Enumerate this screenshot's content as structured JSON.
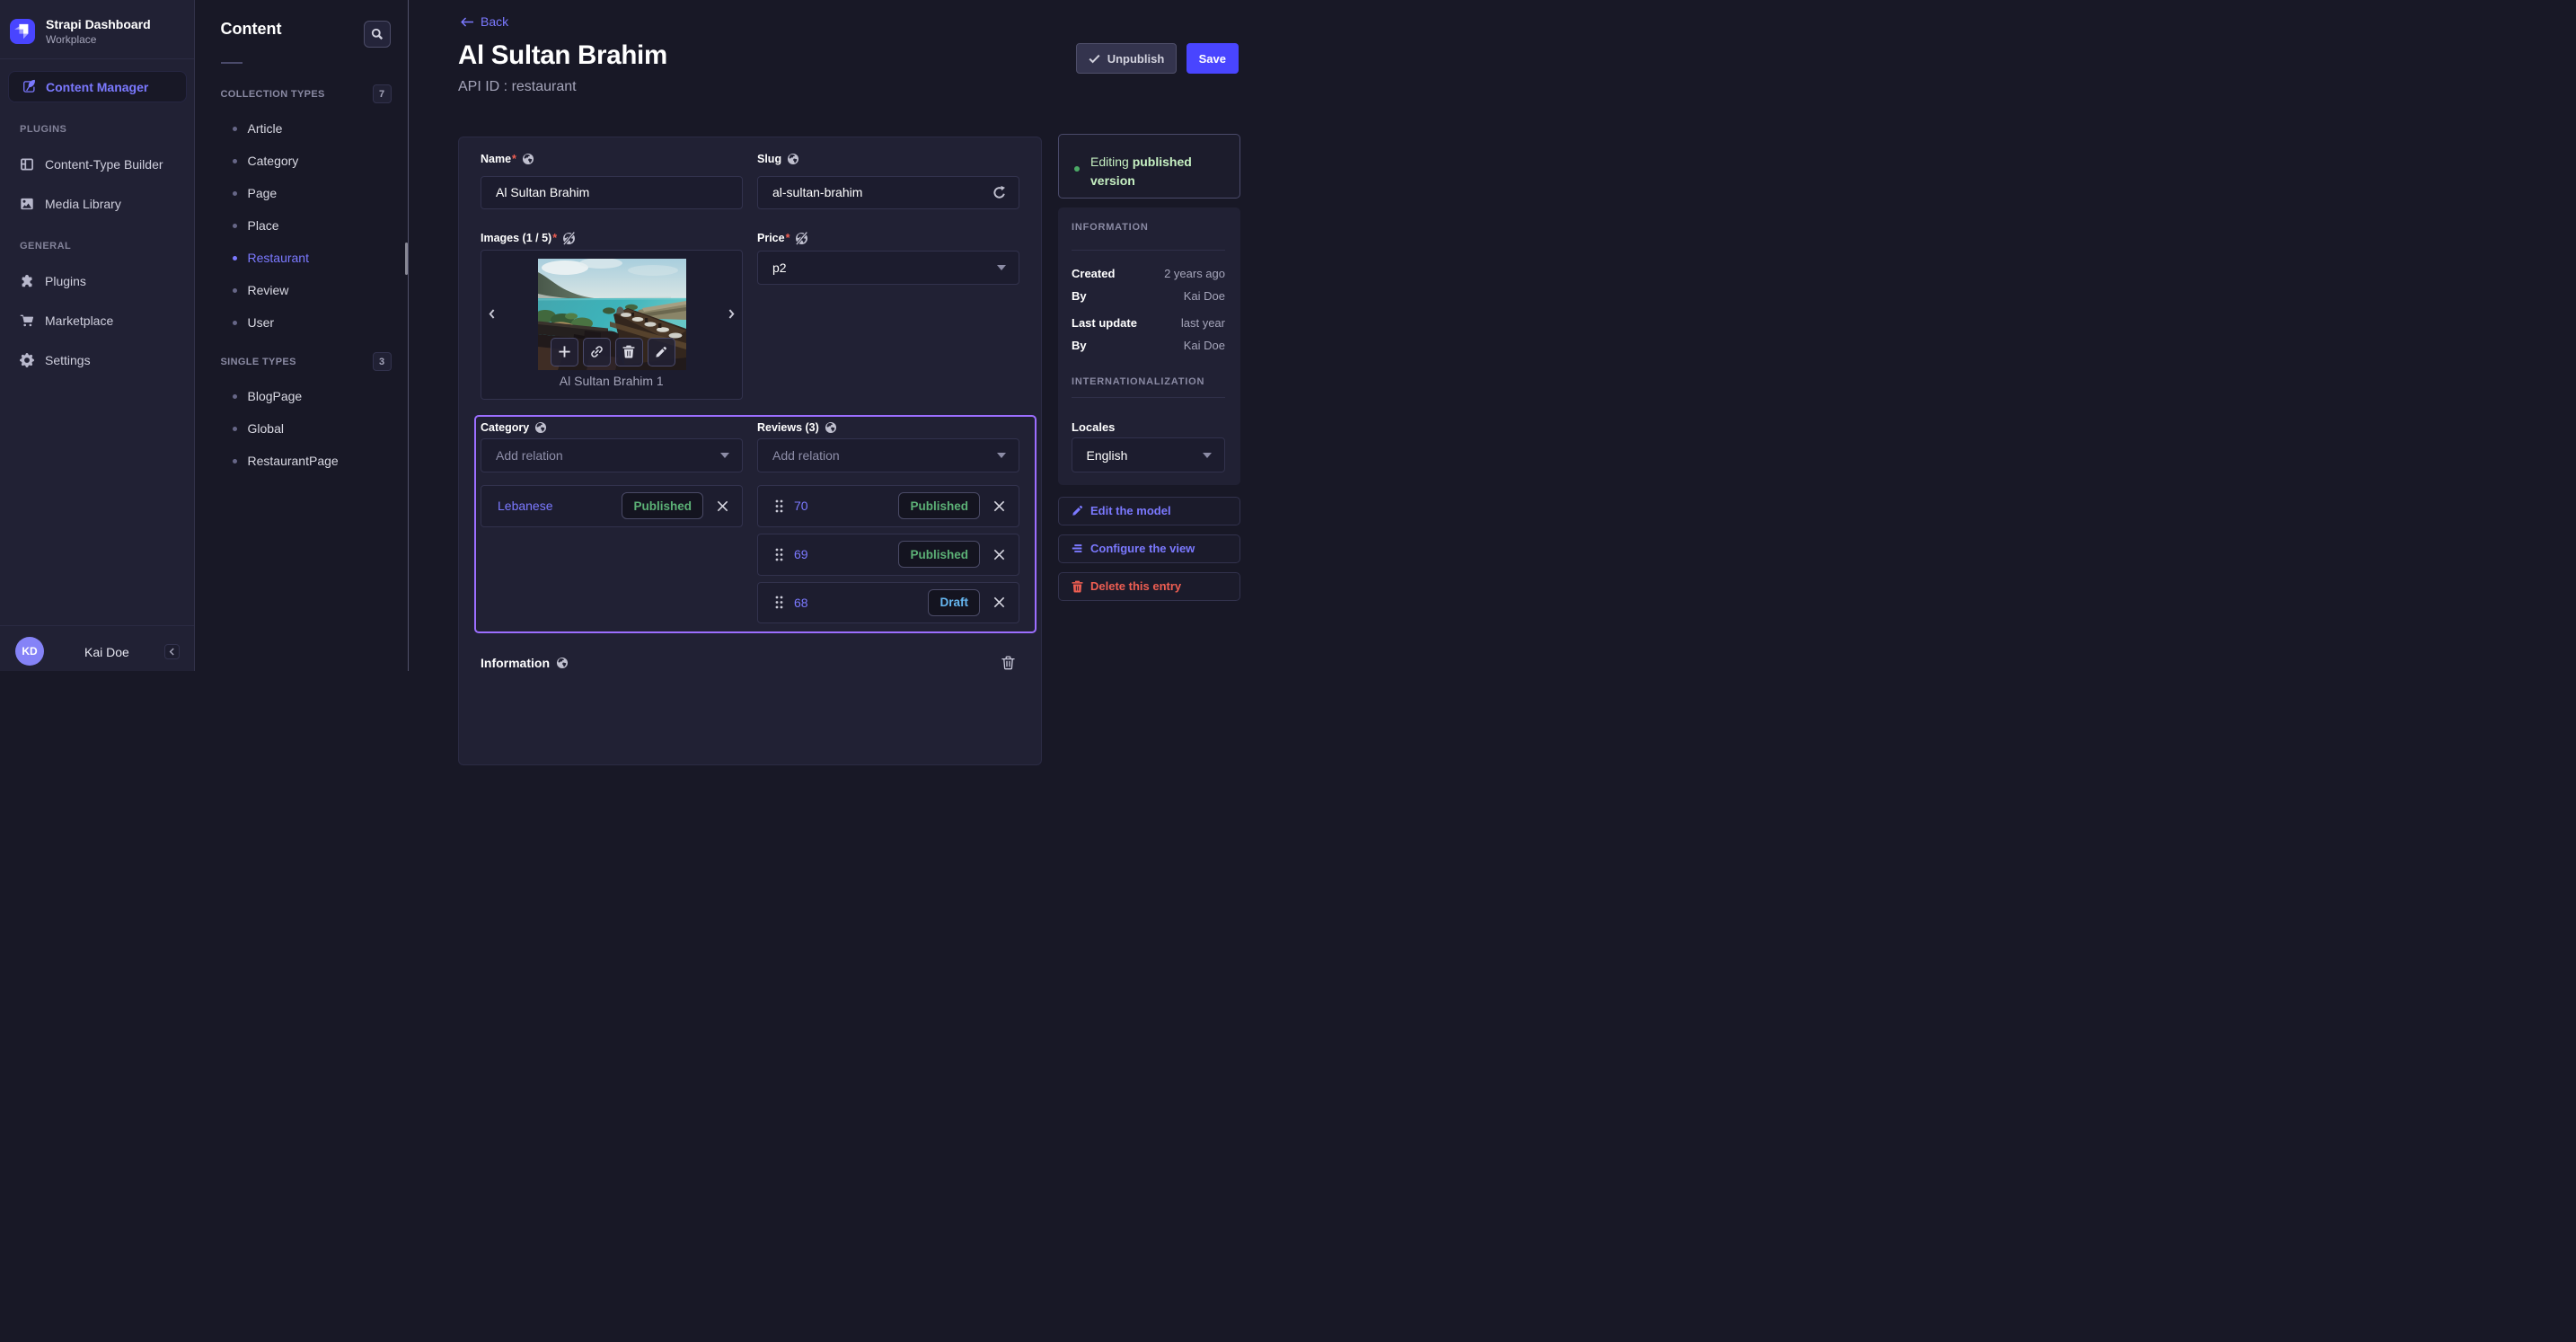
{
  "colors": {
    "accent": "#4945ff",
    "accent_light": "#7b79ff",
    "focus_outline": "#9c6eff",
    "success_text": "#5cb176",
    "success_light": "#c6f0c2",
    "draft_text": "#66b7f1",
    "danger": "#ee5e52"
  },
  "sidebar": {
    "app_title": "Strapi Dashboard",
    "app_subtitle": "Workplace",
    "active_item": "Content Manager",
    "sections": [
      {
        "label": "PLUGINS",
        "items": [
          {
            "label": "Content-Type Builder"
          },
          {
            "label": "Media Library"
          }
        ]
      },
      {
        "label": "GENERAL",
        "items": [
          {
            "label": "Plugins"
          },
          {
            "label": "Marketplace"
          },
          {
            "label": "Settings"
          }
        ]
      }
    ],
    "user": {
      "initials": "KD",
      "name": "Kai Doe"
    }
  },
  "subnav": {
    "title": "Content",
    "collection_types": {
      "label": "COLLECTION TYPES",
      "count": "7",
      "items": [
        {
          "label": "Article"
        },
        {
          "label": "Category"
        },
        {
          "label": "Page"
        },
        {
          "label": "Place"
        },
        {
          "label": "Restaurant"
        },
        {
          "label": "Review"
        },
        {
          "label": "User"
        }
      ]
    },
    "single_types": {
      "label": "SINGLE TYPES",
      "count": "3",
      "items": [
        {
          "label": "BlogPage"
        },
        {
          "label": "Global"
        },
        {
          "label": "RestaurantPage"
        }
      ]
    }
  },
  "header": {
    "back_label": "Back",
    "title": "Al Sultan Brahim",
    "api_id": "API ID : restaurant",
    "unpublish_label": "Unpublish",
    "save_label": "Save"
  },
  "form": {
    "name": {
      "label": "Name",
      "value": "Al Sultan Brahim"
    },
    "slug": {
      "label": "Slug",
      "value": "al-sultan-brahim"
    },
    "images": {
      "label": "Images (1 / 5)",
      "caption": "Al Sultan Brahim 1"
    },
    "price": {
      "label": "Price",
      "value": "p2"
    },
    "category": {
      "label": "Category",
      "placeholder": "Add relation",
      "relations": [
        {
          "name": "Lebanese",
          "status": "Published"
        }
      ]
    },
    "reviews": {
      "label": "Reviews (3)",
      "placeholder": "Add relation",
      "relations": [
        {
          "name": "70",
          "status": "Published"
        },
        {
          "name": "69",
          "status": "Published"
        },
        {
          "name": "68",
          "status": "Draft"
        }
      ]
    },
    "information": {
      "label": "Information"
    }
  },
  "panel": {
    "editing": {
      "normal": "Editing ",
      "bold": "published version"
    },
    "information": {
      "title": "INFORMATION",
      "rows": [
        {
          "label": "Created",
          "value": "2 years ago"
        },
        {
          "label": "By",
          "value": "Kai Doe"
        },
        {
          "label": "Last update",
          "value": "last year"
        },
        {
          "label": "By",
          "value": "Kai Doe"
        }
      ]
    },
    "i18n": {
      "title": "INTERNATIONALIZATION",
      "locales_label": "Locales",
      "locale_value": "English"
    },
    "actions": [
      {
        "label": "Edit the model"
      },
      {
        "label": "Configure the view"
      },
      {
        "label": "Delete this entry"
      }
    ]
  }
}
